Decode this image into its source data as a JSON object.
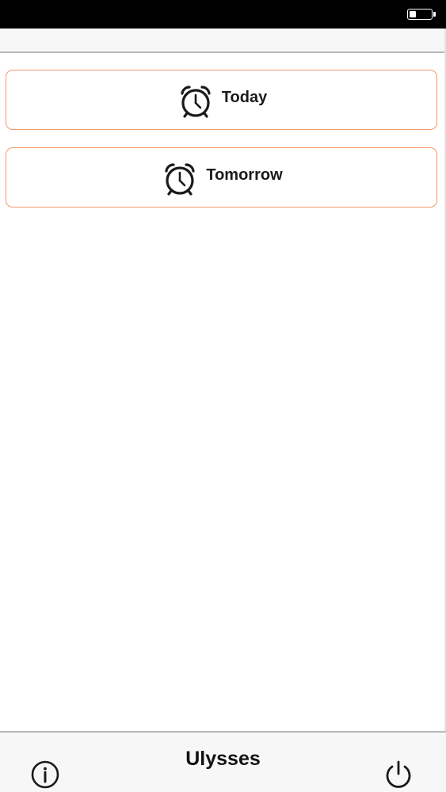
{
  "status_bar": {
    "battery_level": 0.3
  },
  "alarms": {
    "today": {
      "label": "Today",
      "icon": "alarm-clock-icon"
    },
    "tomorrow": {
      "label": "Tomorrow",
      "icon": "alarm-clock-icon"
    }
  },
  "tab_bar": {
    "title": "Ulysses",
    "info_icon": "info-icon",
    "power_icon": "power-icon"
  },
  "colors": {
    "accent_border": "#ef9a6c",
    "status_bar": "#000000",
    "bar_background": "#f7f7f7"
  }
}
